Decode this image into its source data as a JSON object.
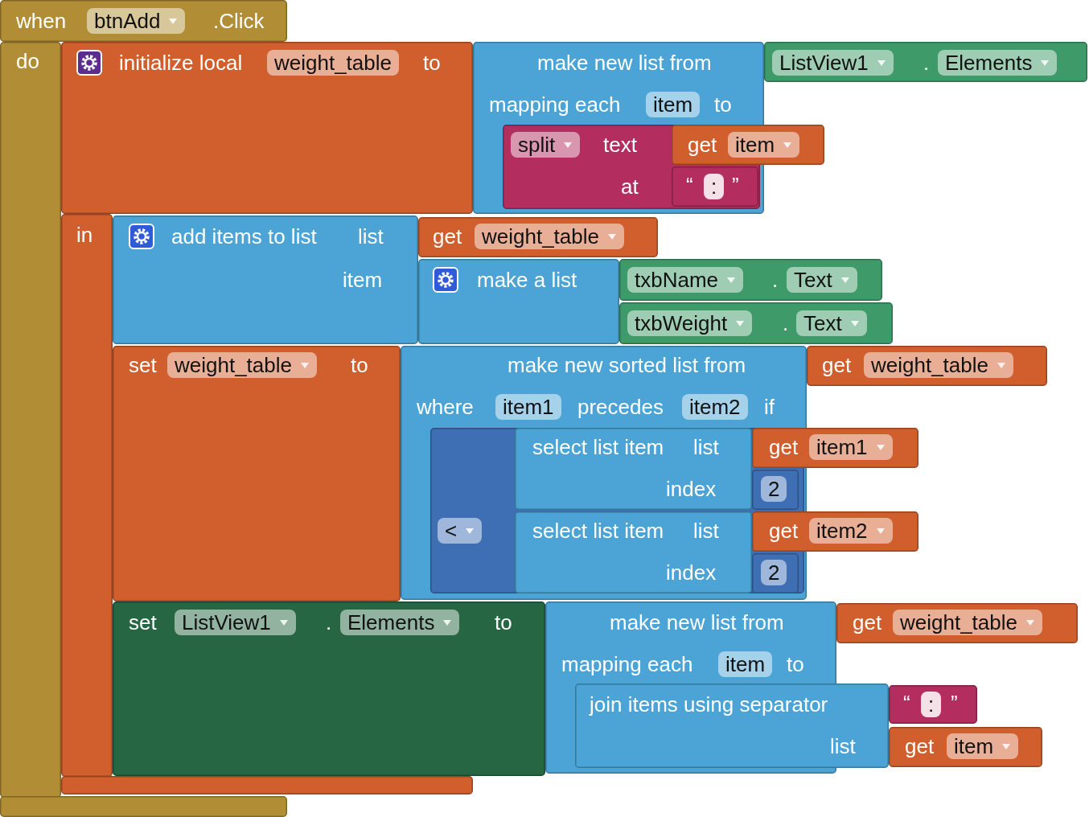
{
  "workspace": {
    "blocks": [
      {
        "kind": "event",
        "color": "#b18e35",
        "parts": [
          {
            "kind": "label",
            "text": "when"
          },
          {
            "kind": "dropdown",
            "text": "btnAdd"
          },
          {
            "kind": "label",
            "text": ".Click"
          },
          {
            "kind": "label",
            "text": "do"
          }
        ]
      },
      {
        "kind": "initialize-local",
        "color": "#d05f2d",
        "parts": [
          {
            "kind": "gear"
          },
          {
            "kind": "label",
            "text": "initialize local"
          },
          {
            "kind": "field",
            "text": "weight_table"
          },
          {
            "kind": "label",
            "text": "to"
          },
          {
            "kind": "label",
            "text": "in"
          }
        ]
      },
      {
        "kind": "map-list",
        "color": "#4ba4d5",
        "parts": [
          {
            "kind": "label",
            "text": "make new list from"
          },
          {
            "kind": "label",
            "text": "mapping each"
          },
          {
            "kind": "field",
            "text": "item"
          },
          {
            "kind": "label",
            "text": "to"
          }
        ]
      },
      {
        "kind": "component-getter",
        "color": "#3f9a69",
        "parts": [
          {
            "kind": "dropdown",
            "text": "ListView1"
          },
          {
            "kind": "label",
            "text": "."
          },
          {
            "kind": "dropdown",
            "text": "Elements"
          }
        ]
      },
      {
        "kind": "split",
        "color": "#b32d5e",
        "parts": [
          {
            "kind": "dropdown",
            "text": "split"
          },
          {
            "kind": "label",
            "text": "text"
          },
          {
            "kind": "label",
            "text": "at"
          }
        ]
      },
      {
        "kind": "get",
        "color": "#d05f2d",
        "parts": [
          {
            "kind": "label",
            "text": "get"
          },
          {
            "kind": "dropdown",
            "text": "item"
          }
        ]
      },
      {
        "kind": "text",
        "color": "#b32d5e",
        "parts": [
          {
            "kind": "label",
            "text": "“"
          },
          {
            "kind": "field",
            "text": ":"
          },
          {
            "kind": "label",
            "text": "”"
          }
        ]
      },
      {
        "kind": "add-items",
        "color": "#4ba4d5",
        "parts": [
          {
            "kind": "gear"
          },
          {
            "kind": "label",
            "text": "add items to list"
          },
          {
            "kind": "label",
            "text": "list"
          },
          {
            "kind": "label",
            "text": "item"
          }
        ]
      },
      {
        "kind": "get",
        "color": "#d05f2d",
        "parts": [
          {
            "kind": "label",
            "text": "get"
          },
          {
            "kind": "dropdown",
            "text": "weight_table"
          }
        ]
      },
      {
        "kind": "make-list",
        "color": "#4ba4d5",
        "parts": [
          {
            "kind": "gear"
          },
          {
            "kind": "label",
            "text": "make a list"
          }
        ]
      },
      {
        "kind": "component-getter",
        "color": "#3f9a69",
        "parts": [
          {
            "kind": "dropdown",
            "text": "txbName"
          },
          {
            "kind": "label",
            "text": "."
          },
          {
            "kind": "dropdown",
            "text": "Text"
          }
        ]
      },
      {
        "kind": "component-getter",
        "color": "#3f9a69",
        "parts": [
          {
            "kind": "dropdown",
            "text": "txbWeight"
          },
          {
            "kind": "label",
            "text": "."
          },
          {
            "kind": "dropdown",
            "text": "Text"
          }
        ]
      },
      {
        "kind": "set",
        "color": "#d05f2d",
        "parts": [
          {
            "kind": "label",
            "text": "set"
          },
          {
            "kind": "dropdown",
            "text": "weight_table"
          },
          {
            "kind": "label",
            "text": "to"
          }
        ]
      },
      {
        "kind": "sort-list",
        "color": "#4ba4d5",
        "parts": [
          {
            "kind": "label",
            "text": "make new sorted list from"
          },
          {
            "kind": "label",
            "text": "where"
          },
          {
            "kind": "field",
            "text": "item1"
          },
          {
            "kind": "label",
            "text": "precedes"
          },
          {
            "kind": "field",
            "text": "item2"
          },
          {
            "kind": "label",
            "text": "if"
          }
        ]
      },
      {
        "kind": "get",
        "color": "#d05f2d",
        "parts": [
          {
            "kind": "label",
            "text": "get"
          },
          {
            "kind": "dropdown",
            "text": "weight_table"
          }
        ]
      },
      {
        "kind": "compare",
        "color": "#3e6fb5",
        "parts": [
          {
            "kind": "dropdown",
            "text": "<"
          }
        ]
      },
      {
        "kind": "select-item",
        "color": "#4ba4d5",
        "parts": [
          {
            "kind": "label",
            "text": "select list item"
          },
          {
            "kind": "label",
            "text": "list"
          },
          {
            "kind": "label",
            "text": "index"
          }
        ]
      },
      {
        "kind": "get",
        "color": "#d05f2d",
        "parts": [
          {
            "kind": "label",
            "text": "get"
          },
          {
            "kind": "dropdown",
            "text": "item1"
          }
        ]
      },
      {
        "kind": "number",
        "color": "#3e6fb5",
        "parts": [
          {
            "kind": "field",
            "text": "2"
          }
        ]
      },
      {
        "kind": "select-item",
        "color": "#4ba4d5",
        "parts": [
          {
            "kind": "label",
            "text": "select list item"
          },
          {
            "kind": "label",
            "text": "list"
          },
          {
            "kind": "label",
            "text": "index"
          }
        ]
      },
      {
        "kind": "get",
        "color": "#d05f2d",
        "parts": [
          {
            "kind": "label",
            "text": "get"
          },
          {
            "kind": "dropdown",
            "text": "item2"
          }
        ]
      },
      {
        "kind": "number",
        "color": "#3e6fb5",
        "parts": [
          {
            "kind": "field",
            "text": "2"
          }
        ]
      },
      {
        "kind": "component-setter",
        "color": "#266642",
        "parts": [
          {
            "kind": "label",
            "text": "set"
          },
          {
            "kind": "dropdown",
            "text": "ListView1"
          },
          {
            "kind": "label",
            "text": "."
          },
          {
            "kind": "dropdown",
            "text": "Elements"
          },
          {
            "kind": "label",
            "text": "to"
          }
        ]
      },
      {
        "kind": "map-list",
        "color": "#4ba4d5",
        "parts": [
          {
            "kind": "label",
            "text": "make new list from"
          },
          {
            "kind": "label",
            "text": "mapping each"
          },
          {
            "kind": "field",
            "text": "item"
          },
          {
            "kind": "label",
            "text": "to"
          }
        ]
      },
      {
        "kind": "get",
        "color": "#d05f2d",
        "parts": [
          {
            "kind": "label",
            "text": "get"
          },
          {
            "kind": "dropdown",
            "text": "weight_table"
          }
        ]
      },
      {
        "kind": "join",
        "color": "#4ba4d5",
        "parts": [
          {
            "kind": "label",
            "text": "join items using separator"
          },
          {
            "kind": "label",
            "text": "list"
          }
        ]
      },
      {
        "kind": "text",
        "color": "#b32d5e",
        "parts": [
          {
            "kind": "label",
            "text": "“"
          },
          {
            "kind": "field",
            "text": ":"
          },
          {
            "kind": "label",
            "text": "”"
          }
        ]
      },
      {
        "kind": "get",
        "color": "#d05f2d",
        "parts": [
          {
            "kind": "label",
            "text": "get"
          },
          {
            "kind": "dropdown",
            "text": "item"
          }
        ]
      }
    ]
  }
}
